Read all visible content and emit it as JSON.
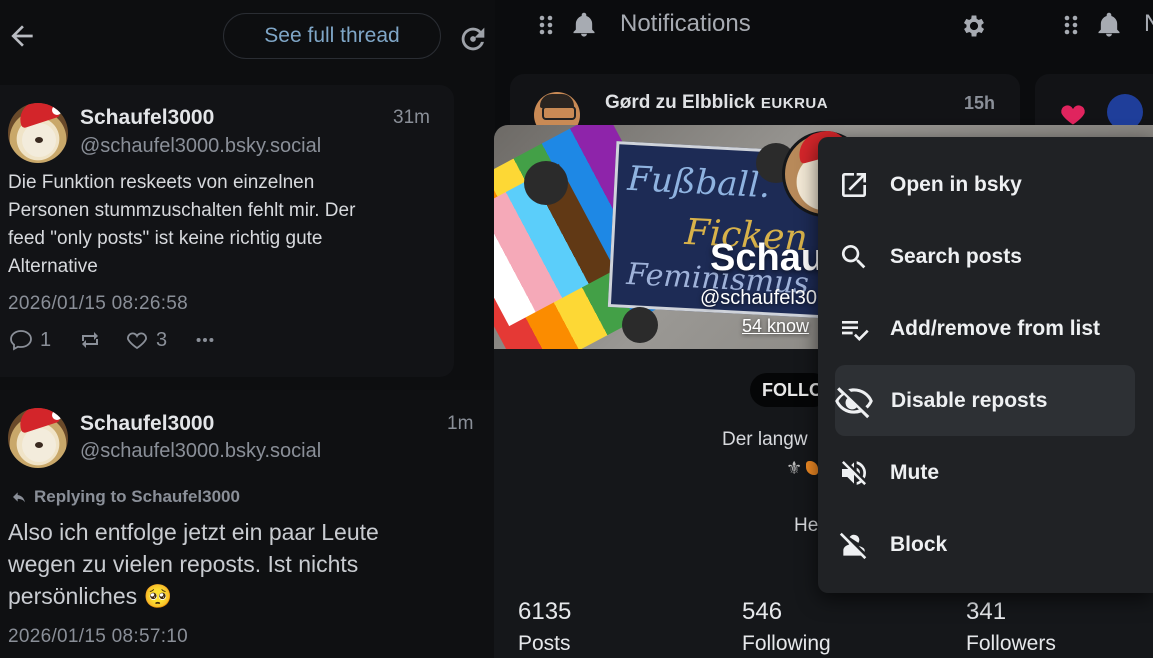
{
  "thread_column": {
    "see_full_thread_label": "See full thread",
    "post1": {
      "display_name": "Schaufel3000",
      "handle": "@schaufel3000.bsky.social",
      "time_ago": "31m",
      "text_lines": [
        "Die Funktion reskeets von einzelnen",
        "Personen stummzuschalten fehlt mir. Der",
        "feed \"only posts\" ist keine richtig gute",
        "Alternative"
      ],
      "date": "2026/01/15 08:26:58",
      "reply_count": "1",
      "like_count": "3"
    },
    "post2": {
      "display_name": "Schaufel3000",
      "handle": "@schaufel3000.bsky.social",
      "time_ago": "1m",
      "replying_to": "Replying to Schaufel3000",
      "text_lines": [
        "Also ich entfolge jetzt ein paar Leute",
        "wegen zu vielen reposts. Ist nichts",
        "persönliches 🥺"
      ],
      "date": "2026/01/15 08:57:10"
    }
  },
  "notifications_column": {
    "title": "Notifications",
    "card": {
      "name": "Gørd zu Elbblick",
      "tag": "EUKRUA",
      "time_ago": "15h"
    },
    "next_column_title_fragment": "N"
  },
  "profile_popover": {
    "name_visible": "Schau",
    "handle_visible": "@schaufel30",
    "known_visible": "54 know",
    "follows_chip": "FOLLO",
    "bio_line1": "Der langw",
    "bio_line2": "He",
    "banner_text": [
      "Fußball.",
      "Ficken",
      "Feminismus"
    ],
    "stats": [
      {
        "value": "6135",
        "label": "Posts"
      },
      {
        "value": "546",
        "label": "Following"
      },
      {
        "value": "341",
        "label": "Followers"
      }
    ]
  },
  "context_menu": {
    "items": [
      {
        "label": "Open in bsky",
        "icon": "open-external-icon"
      },
      {
        "label": "Search posts",
        "icon": "search-icon"
      },
      {
        "label": "Add/remove from list",
        "icon": "playlist-check-icon"
      },
      {
        "label": "Disable reposts",
        "icon": "eye-off-icon"
      },
      {
        "label": "Mute",
        "icon": "volume-off-icon"
      },
      {
        "label": "Block",
        "icon": "person-off-icon"
      }
    ],
    "highlighted_index": 3
  },
  "colors": {
    "background": "#0b0c0e",
    "card": "#121316",
    "menu": "#202225",
    "accent_link": "#7fa6c7",
    "like_heart": "#e0245e"
  }
}
